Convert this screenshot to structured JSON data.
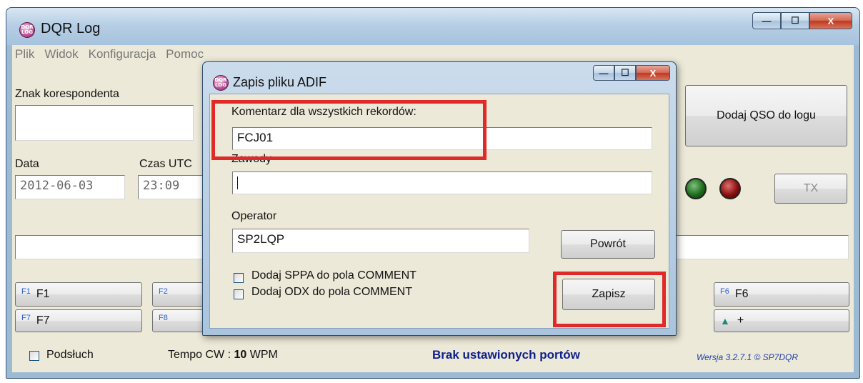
{
  "main": {
    "title": "DQR Log",
    "icon_text": "DQR LOG",
    "min_glyph": "—",
    "max_glyph": "☐",
    "close_glyph": "X",
    "menu": [
      "Plik",
      "Widok",
      "Konfiguracja",
      "Pomoc"
    ],
    "callsign_label": "Znak korespondenta",
    "callsign_value": "",
    "date_label": "Data",
    "date_value": "2012-06-03",
    "time_label": "Czas UTC",
    "time_value": "23:09",
    "add_qso_button": "Dodaj QSO do logu",
    "tx_button": "TX",
    "comment_value": "",
    "fkeys": [
      {
        "key": "F1",
        "label": "F1"
      },
      {
        "key": "F2",
        "label": ""
      },
      {
        "key": "F6",
        "label": "F6"
      },
      {
        "key": "F7",
        "label": "F7"
      },
      {
        "key": "F8",
        "label": ""
      },
      {
        "key": "+",
        "label": "+"
      }
    ],
    "listen_label": "Podsłuch",
    "cw_speed_prefix": "Tempo CW : ",
    "cw_speed_value": "10",
    "cw_speed_unit": " WPM",
    "ports_status": "Brak ustawionych portów",
    "version": "Wersja 3.2.7.1 © SP7DQR",
    "colors": {
      "status_text": "#0d1f8c",
      "version_text": "#1b3fae",
      "highlight": "#e02a2a"
    }
  },
  "dialog": {
    "title": "Zapis pliku ADIF",
    "comment_label": "Komentarz dla wszystkich rekordów:",
    "comment_value": "FCJ01",
    "contest_label": "Zawody",
    "contest_value": "",
    "operator_label": "Operator",
    "operator_value": "SP2LQP",
    "back_button": "Powrót",
    "sppa_checkbox": "Dodaj SPPA do pola COMMENT",
    "odx_checkbox": "Dodaj ODX do pola COMMENT",
    "save_button": "Zapisz"
  }
}
